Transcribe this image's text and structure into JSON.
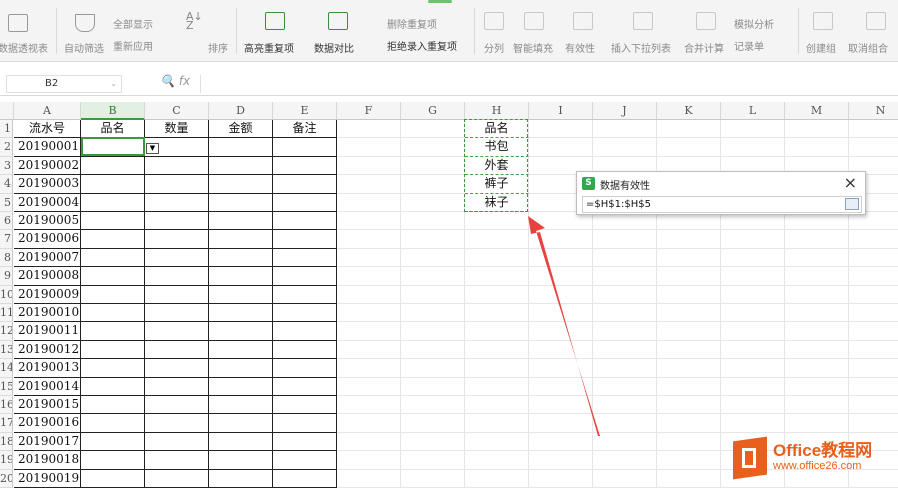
{
  "ribbon": {
    "items": [
      {
        "id": "pivot",
        "label": "数据透视表"
      },
      {
        "id": "autofilter",
        "label": "自动筛选"
      },
      {
        "id": "showall",
        "label": "全部显示"
      },
      {
        "id": "reapply",
        "label": "重新应用"
      },
      {
        "id": "sort",
        "label": "排序"
      },
      {
        "id": "highlight_dup",
        "label": "高亮重复项"
      },
      {
        "id": "compare",
        "label": "数据对比"
      },
      {
        "id": "remove_dup",
        "label": "删除重复项"
      },
      {
        "id": "reject_dup",
        "label": "拒绝录入重复项"
      },
      {
        "id": "split",
        "label": "分列"
      },
      {
        "id": "smartfill",
        "label": "智能填充"
      },
      {
        "id": "validity",
        "label": "有效性"
      },
      {
        "id": "insert_dropdown",
        "label": "插入下拉列表"
      },
      {
        "id": "consolidate",
        "label": "合并计算"
      },
      {
        "id": "whatif",
        "label": "模拟分析"
      },
      {
        "id": "record",
        "label": "记录单"
      },
      {
        "id": "group",
        "label": "创建组"
      },
      {
        "id": "ungroup",
        "label": "取消组合"
      }
    ]
  },
  "formula_bar": {
    "name_box": "B2",
    "fx": "fx",
    "content": ""
  },
  "columns": [
    "A",
    "B",
    "C",
    "D",
    "E",
    "F",
    "G",
    "H",
    "I",
    "J",
    "K",
    "L",
    "M",
    "N"
  ],
  "rows": [
    "1",
    "2",
    "3",
    "4",
    "5",
    "6",
    "7",
    "8",
    "9",
    "10",
    "11",
    "12",
    "13",
    "14",
    "15",
    "16",
    "17",
    "18",
    "19",
    "20"
  ],
  "table": {
    "headers": [
      "流水号",
      "品名",
      "数量",
      "金额",
      "备注"
    ],
    "ids": [
      "20190001",
      "20190002",
      "20190003",
      "20190004",
      "20190005",
      "20190006",
      "20190007",
      "20190008",
      "20190009",
      "20190010",
      "20190011",
      "20190012",
      "20190013",
      "20190014",
      "20190015",
      "20190016",
      "20190017",
      "20190018",
      "20190019"
    ]
  },
  "source_list": [
    "品名",
    "书包",
    "外套",
    "裤子",
    "袜子"
  ],
  "dialog": {
    "title": "数据有效性",
    "logo": "S",
    "close": "×",
    "formula": "=$H$1:$H$5"
  },
  "watermark": {
    "line1": "Office教程网",
    "line2": "www.office26.com"
  },
  "colors": {
    "accent": "#3a9a3a",
    "arrow": "#e8423f",
    "brand": "#e8601c"
  }
}
